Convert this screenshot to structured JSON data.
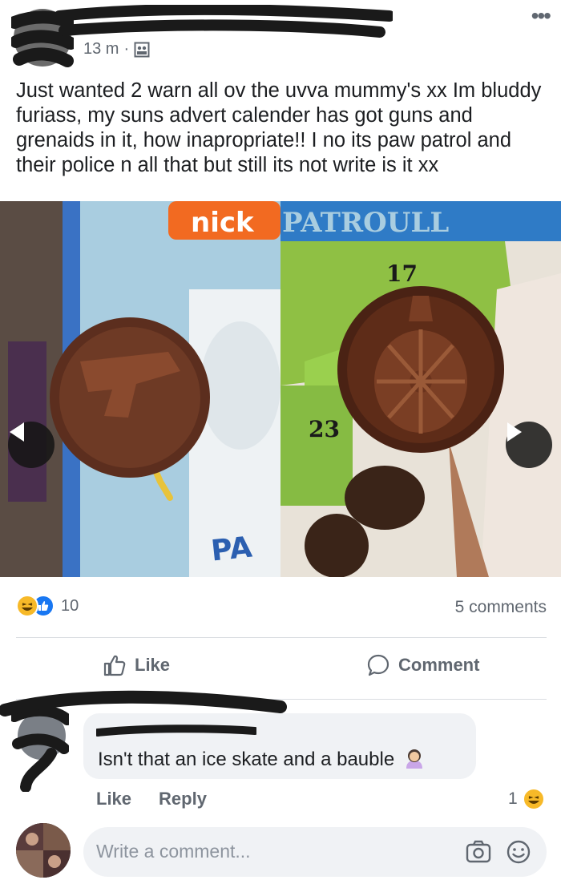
{
  "post": {
    "timestamp": "13 m",
    "separator": "·",
    "more_icon": "more-options-icon",
    "text": "Just wanted 2 warn all ov the uvva mummy's xx Im bluddy furiass, my suns advert calender has got guns and grenaids in it, how inapropriate!! I no its paw patrol and their police n all that but still its not write is it xx"
  },
  "media": {
    "brand_text": "nick",
    "banner_text": "PATROULL",
    "door_number_1": "17",
    "door_number_2": "23",
    "prev_icon": "chevron-left-icon",
    "next_icon": "chevron-right-icon"
  },
  "reactions": {
    "count": "10",
    "comments": "5 comments"
  },
  "actions": {
    "like": "Like",
    "comment": "Comment"
  },
  "comment": {
    "text": "Isn't that an ice skate and a bauble",
    "like": "Like",
    "reply": "Reply",
    "reaction_count": "1"
  },
  "composer": {
    "placeholder": "Write a comment..."
  },
  "colors": {
    "accent": "#1877f2",
    "haha": "#f7b928",
    "muted": "#606770"
  }
}
